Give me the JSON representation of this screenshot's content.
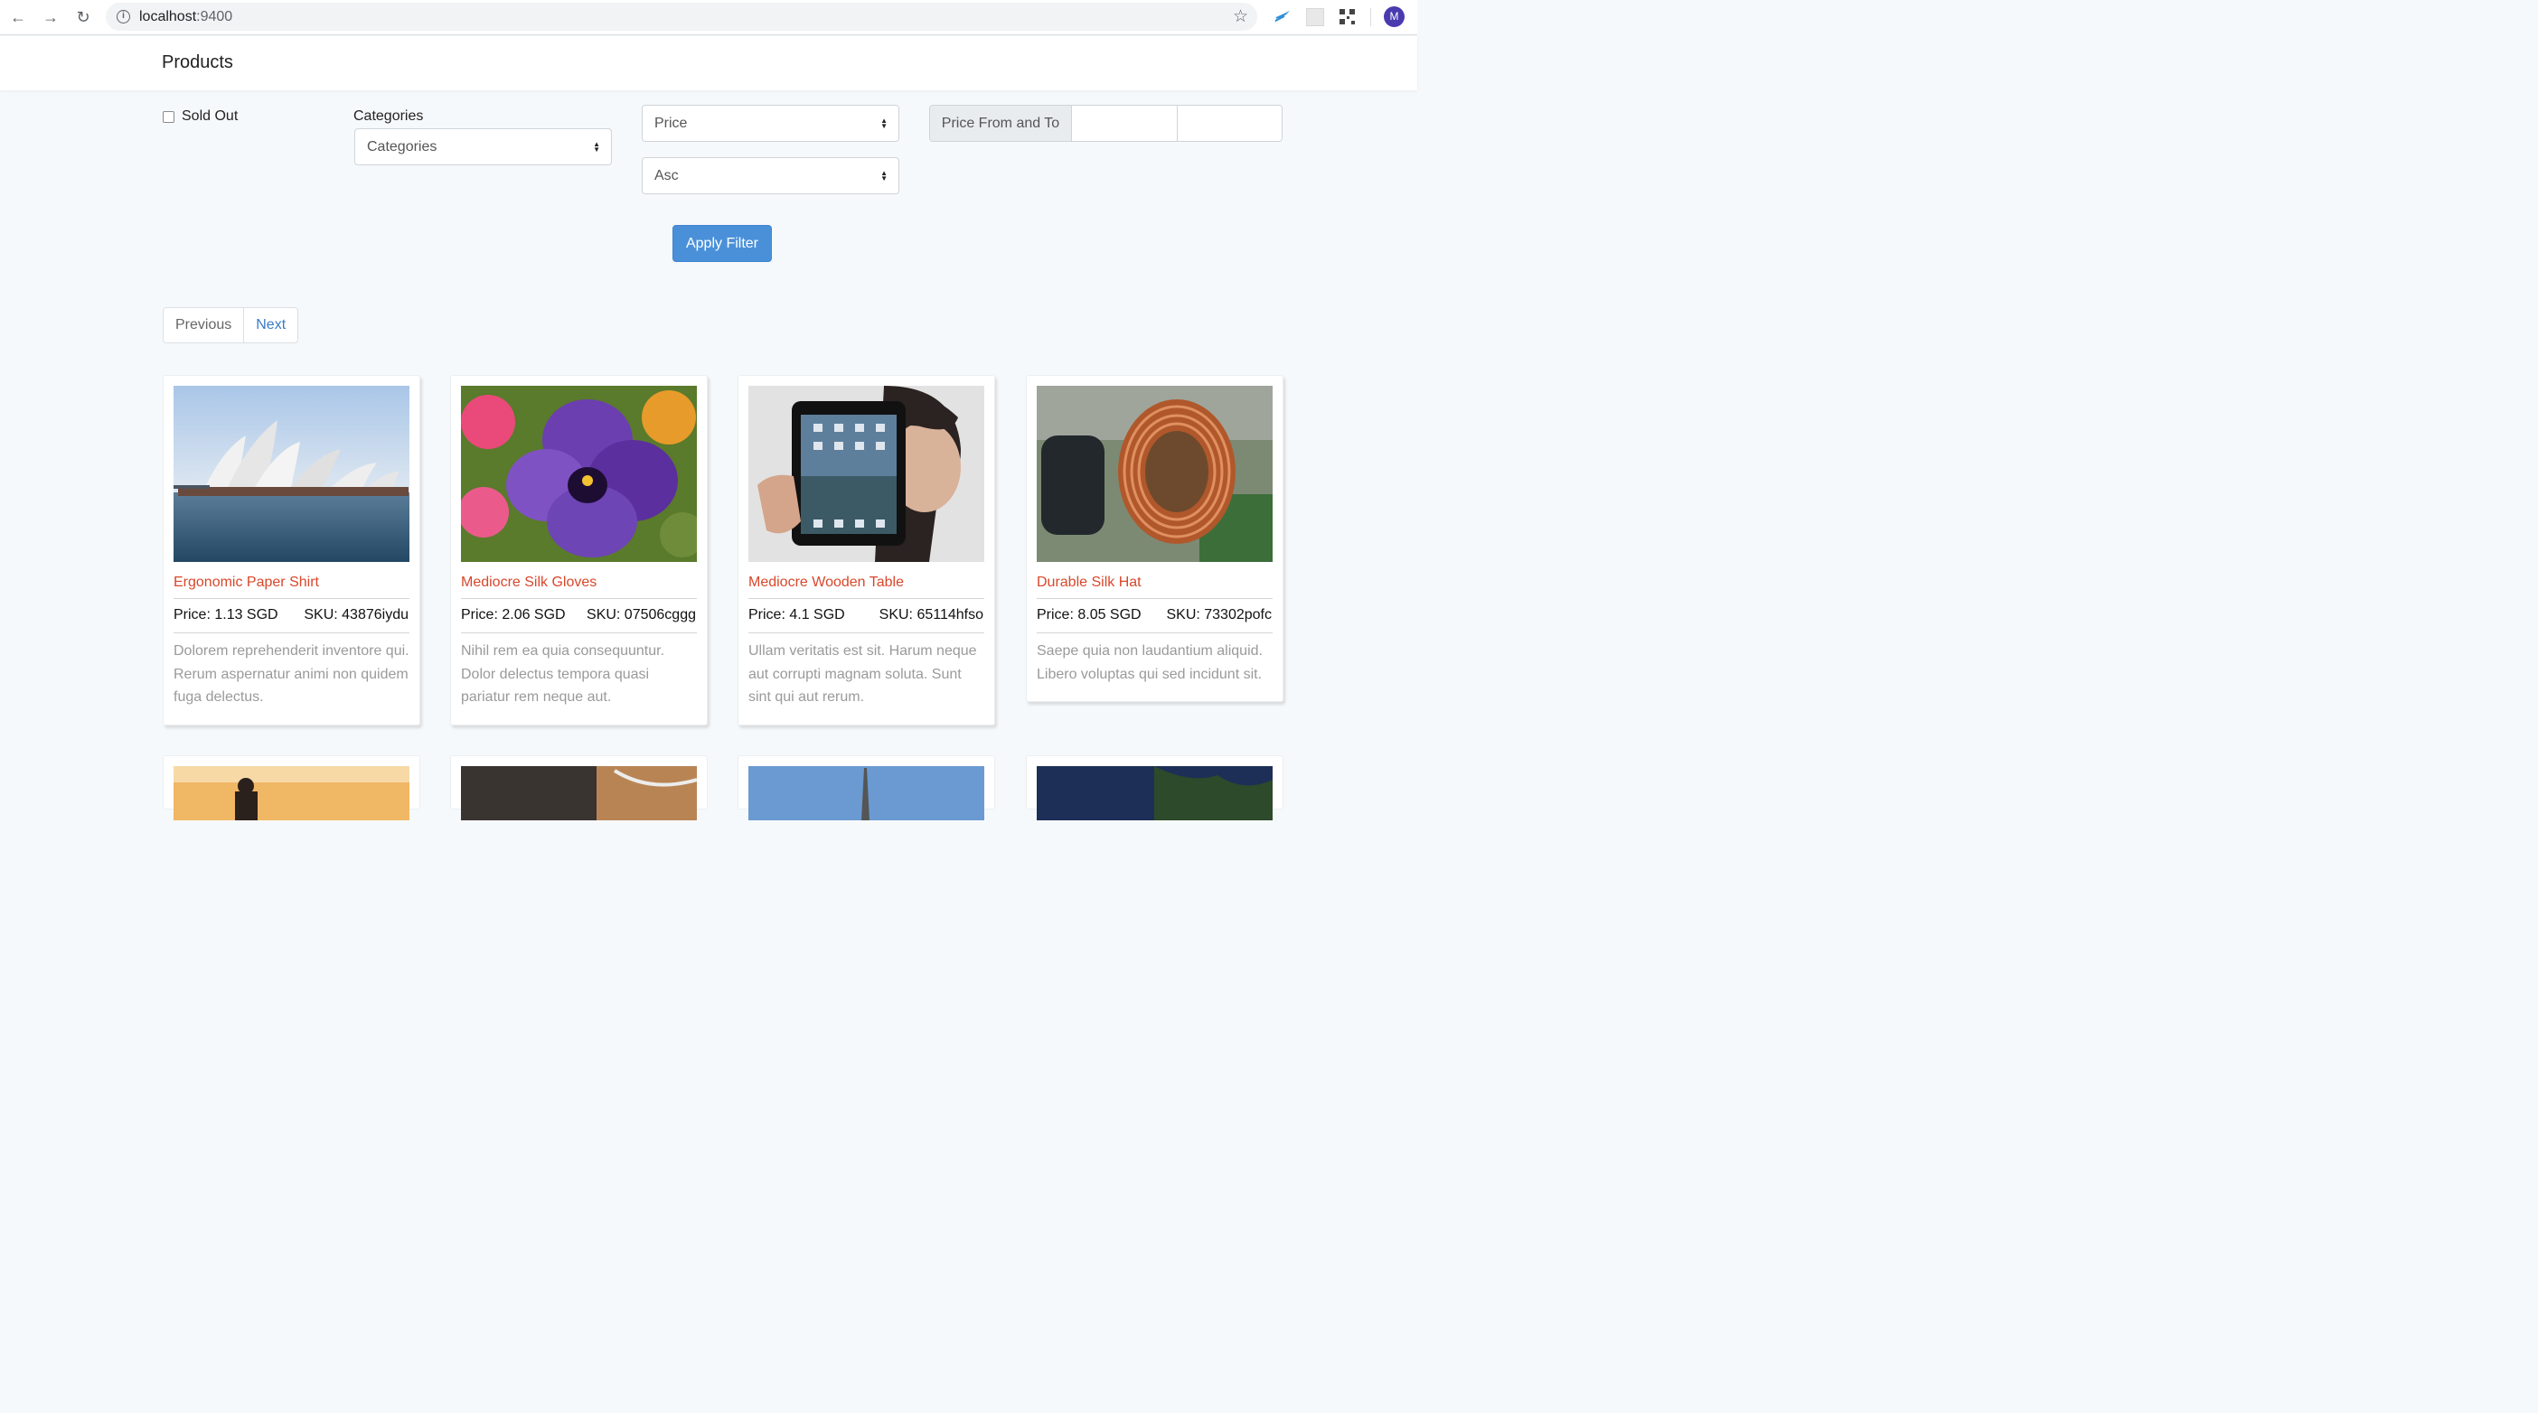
{
  "browser": {
    "url_host": "localhost",
    "url_port": ":9400",
    "profile_initial": "M"
  },
  "header": {
    "title": "Products"
  },
  "filters": {
    "sold_out_label": "Sold Out",
    "categories_label": "Categories",
    "categories_value": "Categories",
    "sort_field_value": "Price",
    "sort_order_value": "Asc",
    "price_range_label": "Price From and To",
    "price_from": "",
    "price_to": "",
    "apply_label": "Apply Filter"
  },
  "pagination": {
    "previous": "Previous",
    "next": "Next"
  },
  "products": [
    {
      "name": "Ergonomic Paper Shirt",
      "price": "Price: 1.13 SGD",
      "sku": "SKU: 43876iydu",
      "description": "Dolorem reprehenderit inventore qui. Rerum aspernatur animi non quidem fuga delectus.",
      "image": "sydney-opera-house"
    },
    {
      "name": "Mediocre Silk Gloves",
      "price": "Price: 2.06 SGD",
      "sku": "SKU: 07506cggg",
      "description": "Nihil rem ea quia consequuntur. Dolor delectus tempora quasi pariatur rem neque aut.",
      "image": "purple-pansy-flower"
    },
    {
      "name": "Mediocre Wooden Table",
      "price": "Price: 4.1 SGD",
      "sku": "SKU: 65114hfso",
      "description": "Ullam veritatis est sit. Harum neque aut corrupti magnam soluta. Sunt sint qui aut rerum.",
      "image": "person-holding-tablet"
    },
    {
      "name": "Durable Silk Hat",
      "price": "Price: 8.05 SGD",
      "sku": "SKU: 73302pofc",
      "description": "Saepe quia non laudantium aliquid. Libero voluptas qui sed incidunt sit.",
      "image": "copper-coil-inductor"
    }
  ],
  "colors": {
    "accent_button": "#4a90d9",
    "product_name": "#d9472b",
    "description_text": "#9a9a9a",
    "link": "#3a7bc8"
  }
}
